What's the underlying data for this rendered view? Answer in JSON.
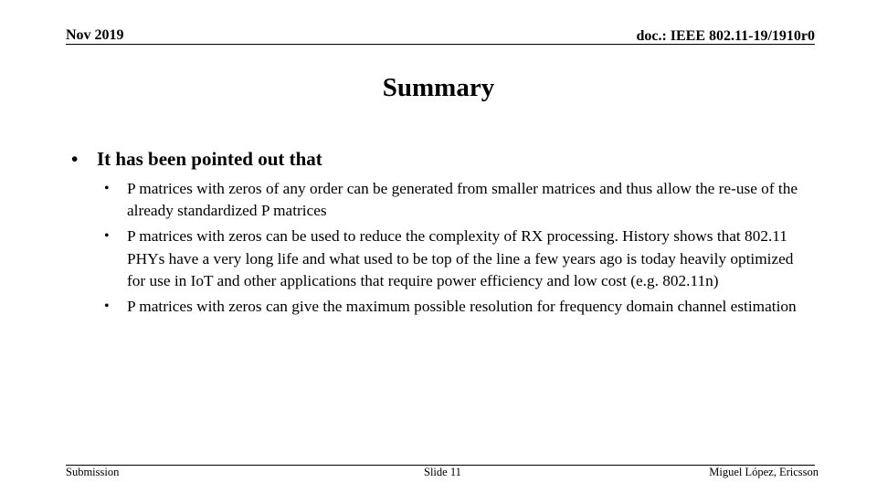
{
  "header": {
    "date": "Nov 2019",
    "doc_id": "doc.: IEEE 802.11-19/1910r0"
  },
  "slide": {
    "title": "Summary",
    "main_bullet": "It has been pointed out that",
    "sub_bullets": [
      "P matrices with zeros of any order can be generated from smaller matrices and thus allow the re-use of the already standardized P matrices",
      "P matrices with zeros can be used to reduce the complexity of RX processing. History shows that 802.11 PHYs have a very long life and what used to be top of the line a few years ago is today heavily optimized for use in IoT and other applications that require power efficiency and low cost (e.g. 802.11n)",
      "P matrices with zeros can give the maximum possible resolution for frequency domain channel estimation"
    ]
  },
  "footer": {
    "left": "Submission",
    "center": "Slide 11",
    "right": "Miguel López, Ericsson"
  }
}
